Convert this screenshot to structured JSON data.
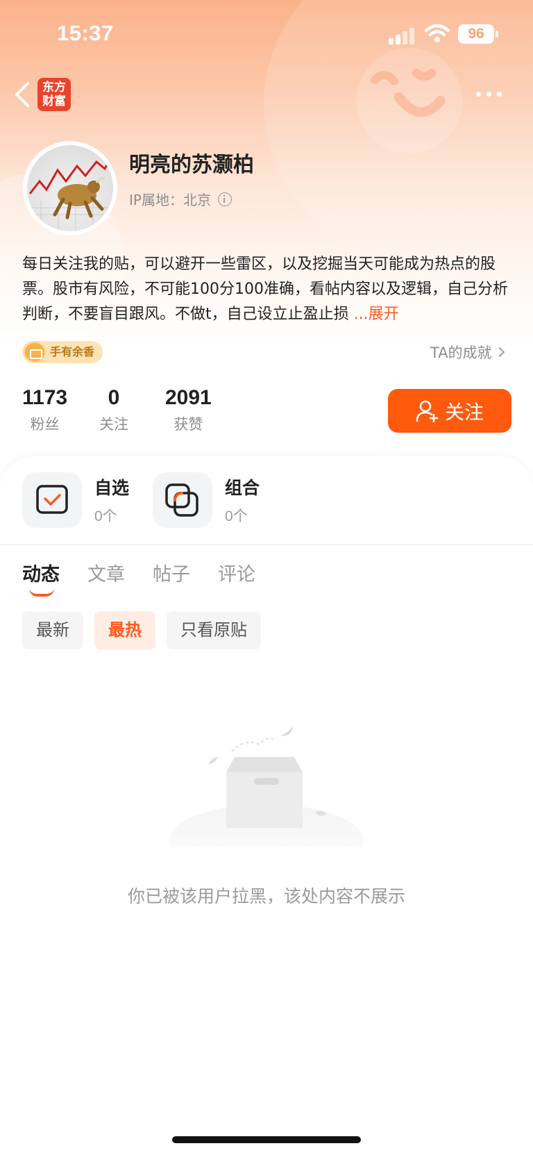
{
  "status_bar": {
    "time": "15:37",
    "battery": "96"
  },
  "brand": {
    "logo_line1": "东方",
    "logo_line2": "财富"
  },
  "profile": {
    "username": "明亮的苏灏柏",
    "ip_label": "IP属地：北京",
    "bio": "每日关注我的贴，可以避开一些雷区，以及挖掘当天可能成为热点的股票。股市有风险，不可能100分100准确，看帖内容以及逻辑，自己分析判断，不要盲目跟风。不做t，自己设立止盈止损",
    "bio_expand": "...展开",
    "badge": "手有余香",
    "achievement": "TA的成就"
  },
  "stats": [
    {
      "value": "1173",
      "label": "粉丝"
    },
    {
      "value": "0",
      "label": "关注"
    },
    {
      "value": "2091",
      "label": "获赞"
    }
  ],
  "follow_button": "关注",
  "tools": [
    {
      "title": "自选",
      "count": "0个"
    },
    {
      "title": "组合",
      "count": "0个"
    }
  ],
  "tabs": [
    "动态",
    "文章",
    "帖子",
    "评论"
  ],
  "filters": [
    "最新",
    "最热",
    "只看原贴"
  ],
  "empty_message": "你已被该用户拉黑，该处内容不展示",
  "colors": {
    "accent": "#ff5a0e",
    "header_gradient_top": "#fbb28a"
  }
}
